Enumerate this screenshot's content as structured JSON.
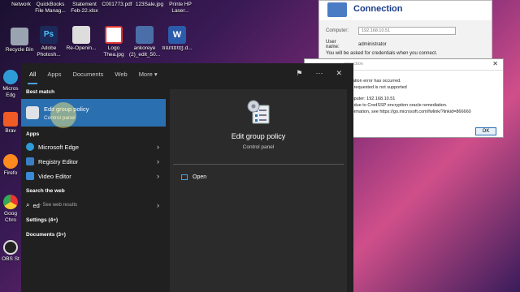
{
  "desktop": {
    "top_labels": [
      "Network",
      "QuickBooks\nFile Manag...",
      "Statement\nFeb-22.xlsx",
      "C001773.pdf",
      "123Sale.jpg",
      "Printe HP\nLaser..."
    ],
    "icons": [
      {
        "label": "Recycle Bin",
        "color": "#9aa4b0"
      },
      {
        "label": "Adobe\nPhotosh...",
        "color": "#1b2a58"
      },
      {
        "label": "Re-Openin...",
        "color": "#ddd"
      },
      {
        "label": "Logo\nThea.jpg",
        "color": "#ffffff"
      },
      {
        "label": "ankoreye\n(2)_edit_50...",
        "color": "#4a6ea8"
      },
      {
        "label": "គណនេយ្យ.d...",
        "color": "#2b5cab"
      }
    ],
    "side_labels": [
      "Micros\nEdg",
      "Brav",
      "Firefo",
      "Goog\nChro",
      "OBS St"
    ]
  },
  "start_menu": {
    "tabs": [
      "All",
      "Apps",
      "Documents",
      "Web",
      "More ▾"
    ],
    "tab_icons": {
      "feedback": "⚑",
      "more": "···",
      "close": "✕"
    },
    "best_match_header": "Best match",
    "best_match": {
      "title": "Edit group policy",
      "subtitle": "Control panel"
    },
    "apps_header": "Apps",
    "apps": [
      {
        "label": "Microsoft Edge",
        "color": "#2f9bd6"
      },
      {
        "label": "Registry Editor",
        "color": "#3a7fc4"
      },
      {
        "label": "Video Editor",
        "color": "#3a8ad6"
      }
    ],
    "web_header": "Search the web",
    "web_query": "ed",
    "web_suffix": " - See web results",
    "settings": "Settings (4+)",
    "documents": "Documents (3+)",
    "preview": {
      "title": "Edit group policy",
      "subtitle": "Control panel",
      "action": "Open"
    }
  },
  "rdp": {
    "title": "Connection",
    "computer_label": "Computer:",
    "computer_value": "192.168.10.51",
    "username_label": "User name:",
    "username_value": "administrator",
    "note": "You will be asked for credentials when you connect."
  },
  "error": {
    "title": "onnection",
    "lines": [
      "cation error has occurred.",
      "n requested is not supported",
      "",
      "mputer: 192.168.10.51",
      "e due to CredSSP encryption oracle remediation.",
      "formation, see https://go.microsoft.com/fwlink/?linkid=866660"
    ],
    "ok": "OK"
  }
}
